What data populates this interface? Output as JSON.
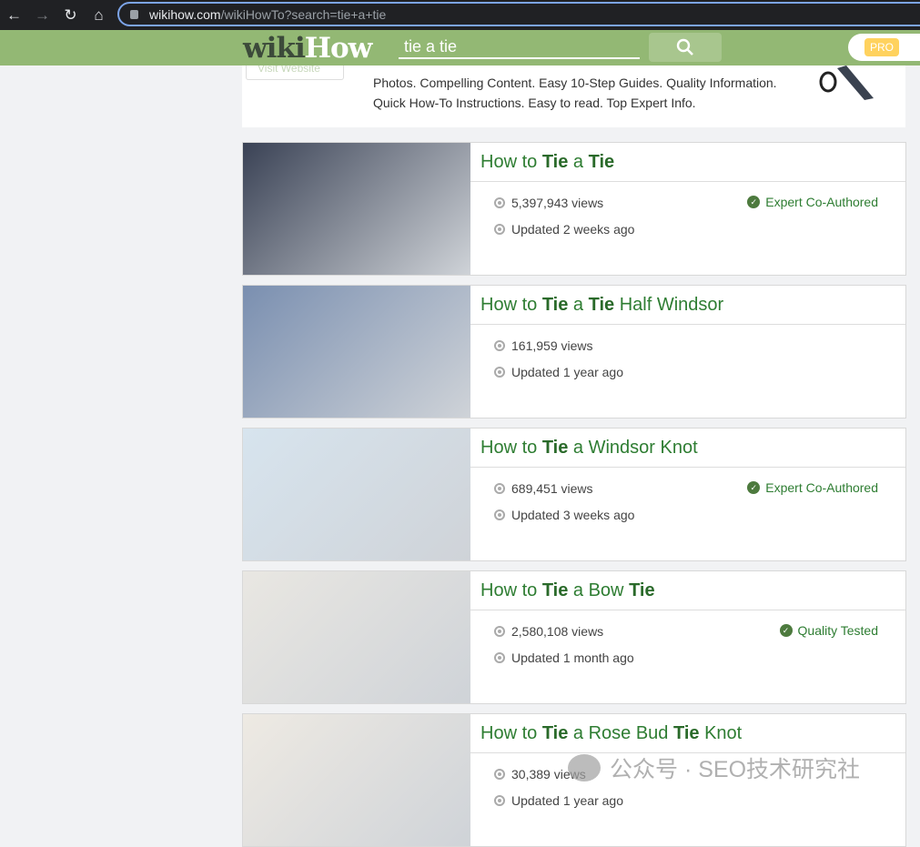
{
  "browser": {
    "url_host": "wikihow.com",
    "url_path": "/wikiHowTo?search=tie+a+tie"
  },
  "header": {
    "logo_wiki": "wiki",
    "logo_how": "How",
    "search_value": "tie a tie",
    "pro_label": "PRO"
  },
  "ad": {
    "visit_label": "Visit Website",
    "line1": "Photos. Compelling Content. Easy 10-Step Guides. Quality Information.",
    "line2": "Quick How-To Instructions. Easy to read. Top Expert Info."
  },
  "results": [
    {
      "title": [
        [
          "How to ",
          0
        ],
        [
          "Tie",
          1
        ],
        [
          " a ",
          0
        ],
        [
          "Tie",
          1
        ]
      ],
      "views": "5,397,943 views",
      "updated": "Updated 2 weeks ago",
      "badge": "Expert Co-Authored",
      "thumb": "#3a4255"
    },
    {
      "title": [
        [
          "How to ",
          0
        ],
        [
          "Tie",
          1
        ],
        [
          " a ",
          0
        ],
        [
          "Tie",
          1
        ],
        [
          " Half Windsor",
          0
        ]
      ],
      "views": "161,959 views",
      "updated": "Updated 1 year ago",
      "badge": "",
      "thumb": "#7a8fb0"
    },
    {
      "title": [
        [
          "How to ",
          0
        ],
        [
          "Tie",
          1
        ],
        [
          " a Windsor Knot",
          0
        ]
      ],
      "views": "689,451 views",
      "updated": "Updated 3 weeks ago",
      "badge": "Expert Co-Authored",
      "thumb": "#d7e4ee"
    },
    {
      "title": [
        [
          "How to ",
          0
        ],
        [
          "Tie",
          1
        ],
        [
          " a Bow ",
          0
        ],
        [
          "Tie",
          1
        ]
      ],
      "views": "2,580,108 views",
      "updated": "Updated 1 month ago",
      "badge": "Quality Tested",
      "thumb": "#e9e7e2"
    },
    {
      "title": [
        [
          "How to ",
          0
        ],
        [
          "Tie",
          1
        ],
        [
          " a Rose Bud ",
          0
        ],
        [
          "Tie",
          1
        ],
        [
          " Knot",
          0
        ]
      ],
      "views": "30,389 views",
      "updated": "Updated 1 year ago",
      "badge": "",
      "thumb": "#eeeae3"
    }
  ],
  "watermark": "公众号 · SEO技术研究社"
}
